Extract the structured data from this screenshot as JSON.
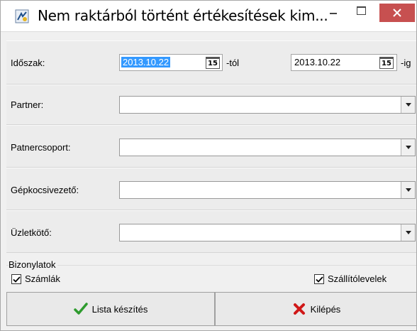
{
  "window": {
    "title": "Nem raktárból történt értékesítések kim..."
  },
  "period": {
    "label": "Időszak:",
    "from_value": "2013.10.22",
    "from_suffix": "-tól",
    "to_value": "2013.10.22",
    "to_suffix": "-ig",
    "calendar_icon_text": "15"
  },
  "fields": {
    "partner_label": "Partner:",
    "partner_group_label": "Patnercsoport:",
    "driver_label": "Gépkocsivezető:",
    "dealer_label": "Üzletkötő:"
  },
  "documents": {
    "title": "Bizonylatok",
    "invoices_label": "Számlák",
    "invoices_checked": true,
    "delivery_notes_label": "Szállítólevelek",
    "delivery_notes_checked": true
  },
  "buttons": {
    "create_list_label": "Lista készítés",
    "exit_label": "Kilépés"
  },
  "colors": {
    "close_button": "#c75050",
    "selection": "#3399ff",
    "check_icon": "#2e9b2e",
    "exit_icon": "#d01818"
  },
  "icons": {
    "app": "app-icon",
    "calendar": "calendar-icon",
    "create_list": "check-icon",
    "exit": "x-icon"
  }
}
